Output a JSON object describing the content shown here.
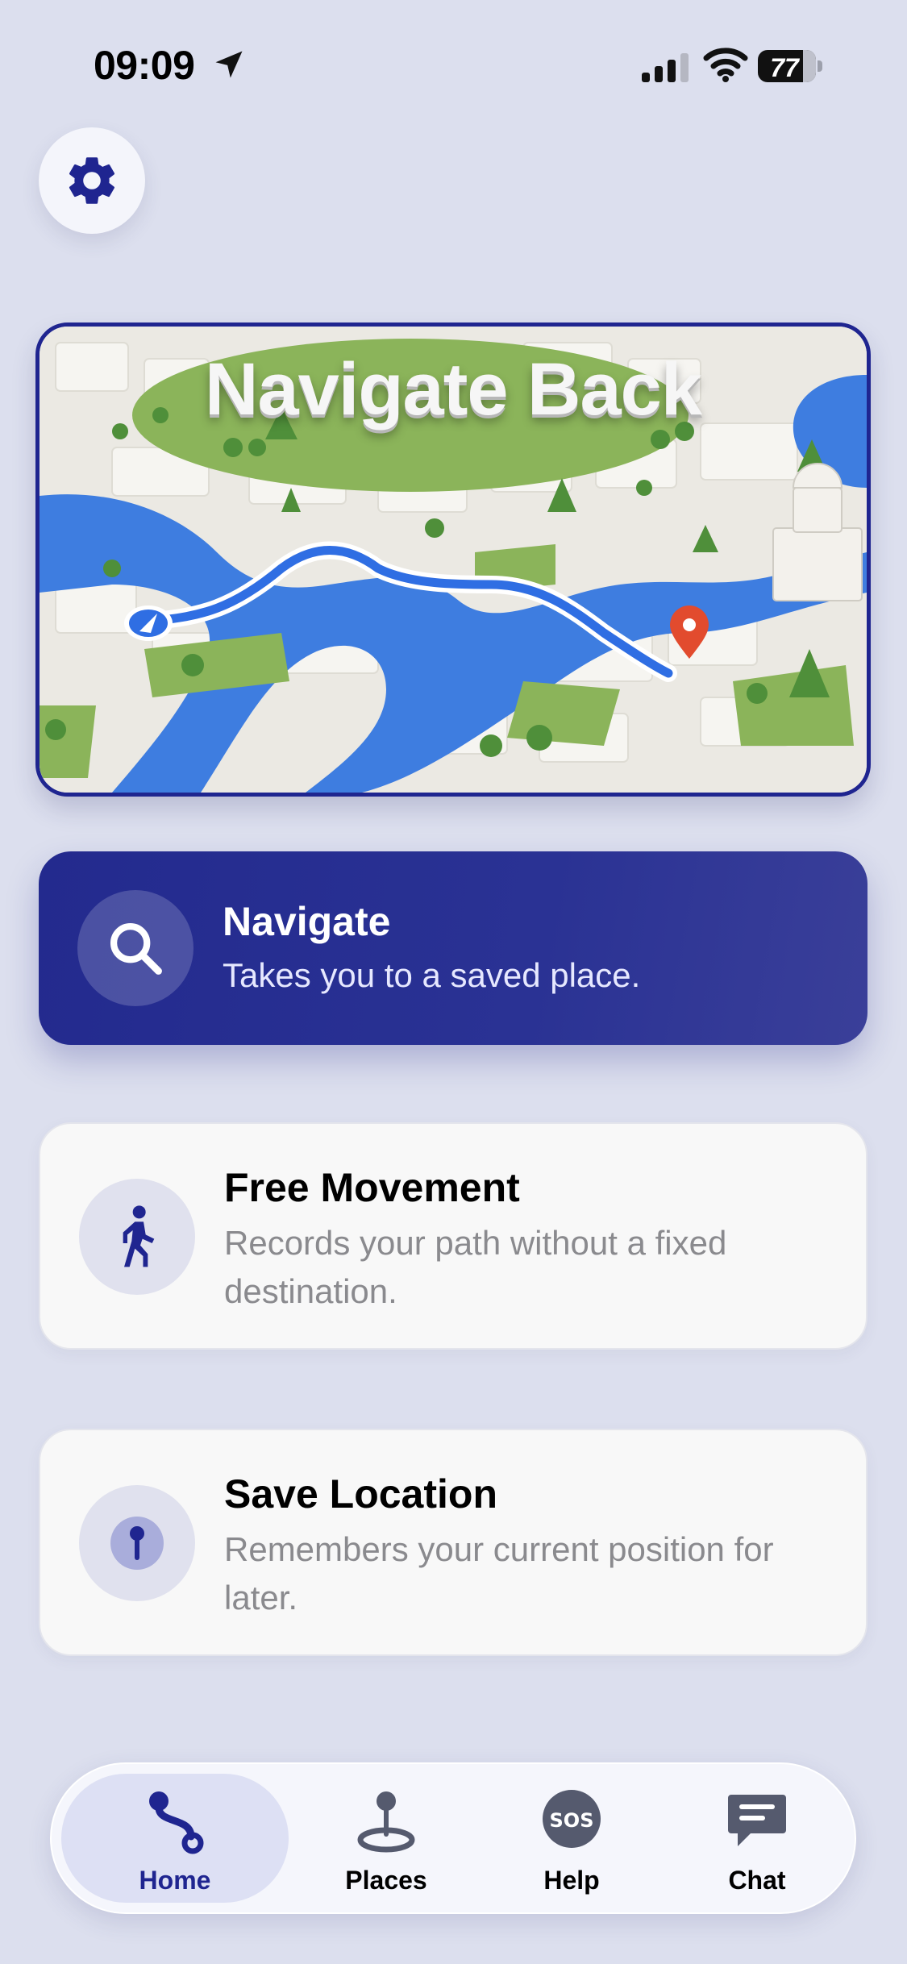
{
  "status_bar": {
    "time": "09:09",
    "battery": "77",
    "icons": [
      "location-arrow-icon",
      "cellular-signal-icon",
      "wifi-icon",
      "battery-icon"
    ]
  },
  "settings": {
    "icon": "gear-icon"
  },
  "hero": {
    "title": "Navigate Back"
  },
  "cards": [
    {
      "title": "Navigate",
      "description": "Takes you to a saved place.",
      "icon": "search-icon"
    },
    {
      "title": "Free Movement",
      "description": "Records your path without a fixed destination.",
      "icon": "walking-person-icon"
    },
    {
      "title": "Save Location",
      "description": "Remembers your current position for later.",
      "icon": "pin-icon"
    }
  ],
  "tabs": [
    {
      "label": "Home",
      "icon": "route-icon",
      "active": true
    },
    {
      "label": "Places",
      "icon": "map-pin-icon",
      "active": false
    },
    {
      "label": "Help",
      "icon": "sos-icon",
      "active": false
    },
    {
      "label": "Chat",
      "icon": "chat-bubble-icon",
      "active": false
    }
  ],
  "colors": {
    "accent": "#1f2590",
    "background": "#dcdfee",
    "water": "#3e7de0",
    "park": "#8bb45a",
    "destination_pin": "#e24b2e"
  }
}
